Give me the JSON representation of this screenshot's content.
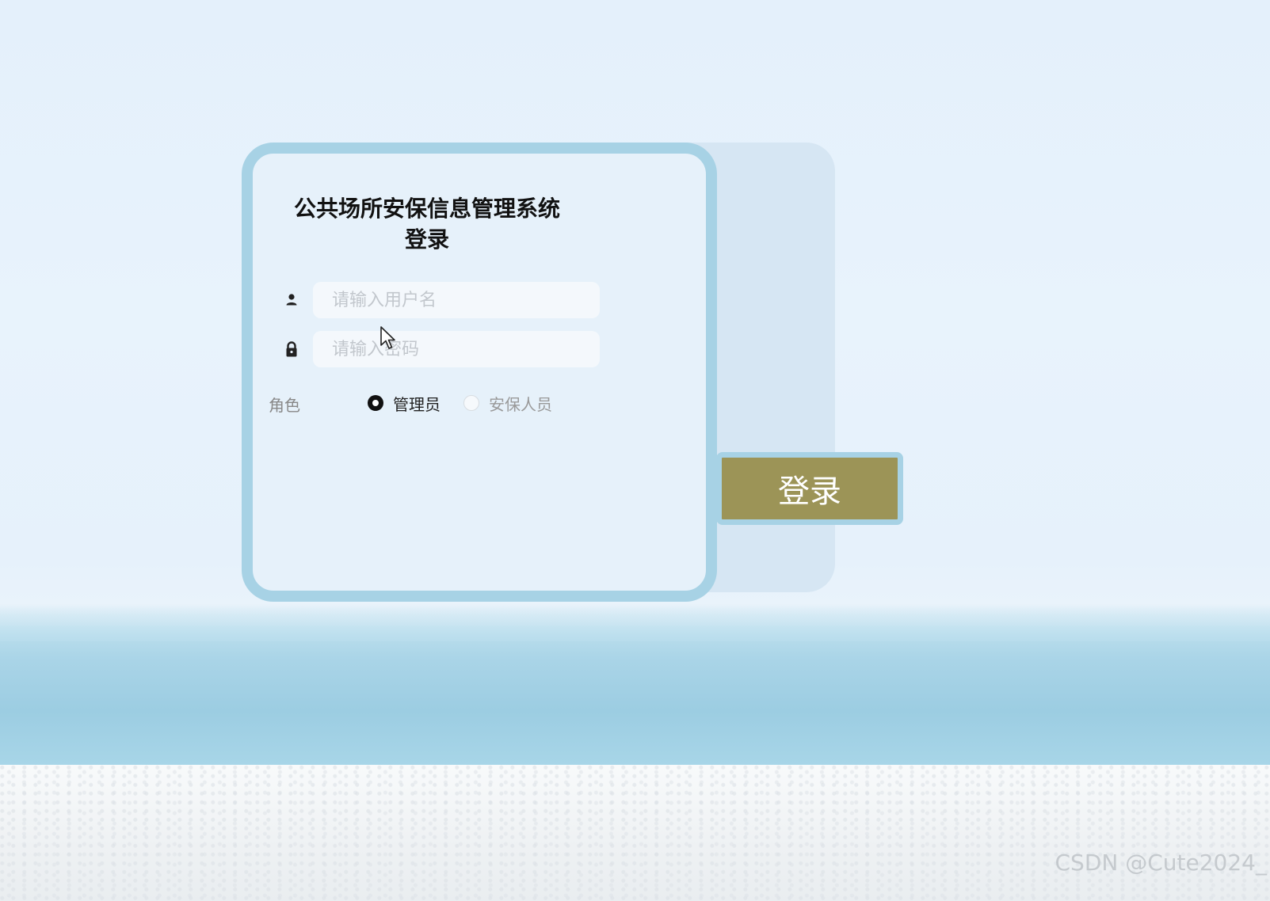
{
  "login": {
    "title_line1": "公共场所安保信息管理系统",
    "title_line2": "登录",
    "username": {
      "icon": "user-icon",
      "placeholder": "请输入用户名",
      "value": ""
    },
    "password": {
      "icon": "lock-icon",
      "placeholder": "请输入密码",
      "value": ""
    },
    "role": {
      "label": "角色",
      "options": [
        {
          "label": "管理员",
          "selected": true
        },
        {
          "label": "安保人员",
          "selected": false
        }
      ]
    },
    "submit_label": "登录"
  },
  "watermark": "CSDN @Cute2024_",
  "colors": {
    "card_border": "#a7d2e5",
    "card_bg": "#e6f1fa",
    "back_panel": "#d6e6f3",
    "button_bg": "#9c9457",
    "button_text": "#ffffff"
  }
}
